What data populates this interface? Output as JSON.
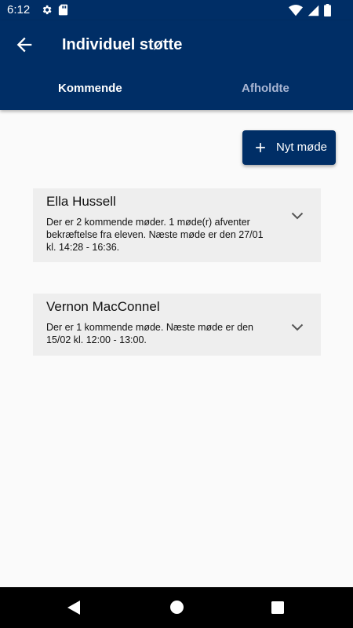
{
  "status_bar": {
    "time": "6:12",
    "left_icons": [
      "gear-icon",
      "sd-card-icon"
    ],
    "right_icons": [
      "wifi-icon",
      "signal-icon",
      "battery-icon"
    ]
  },
  "app_bar": {
    "title": "Individuel støtte",
    "back_icon": "arrow-left-icon"
  },
  "tabs": [
    {
      "label": "Kommende",
      "selected": true
    },
    {
      "label": "Afholdte",
      "selected": false
    }
  ],
  "new_meeting_button": {
    "label": "Nyt møde",
    "icon": "plus-icon"
  },
  "students": [
    {
      "name": "Ella Hussell",
      "summary": "Der er 2 kommende møder. 1 møde(r) afventer bekræftelse fra eleven. Næste møde er den 27/01 kl. 14:28 - 16:36."
    },
    {
      "name": "Vernon MacConnel",
      "summary": "Der er 1 kommende møde. Næste møde er den 15/02 kl. 12:00 - 13:00."
    }
  ],
  "colors": {
    "primary": "#002e66",
    "tab_inactive": "#a9b6d3",
    "card_bg": "#eeeeee",
    "page_bg": "#fafafa"
  },
  "nav_bar": {
    "icons": [
      "back-triangle-icon",
      "home-circle-icon",
      "recents-square-icon"
    ]
  }
}
